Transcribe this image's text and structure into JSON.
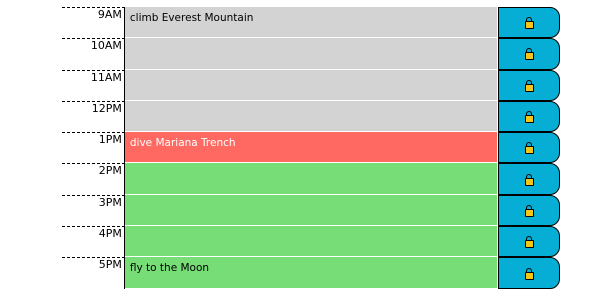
{
  "schedule": {
    "rows": [
      {
        "hour": "9AM",
        "text": "climb Everest Mountain",
        "state": "past"
      },
      {
        "hour": "10AM",
        "text": "",
        "state": "past"
      },
      {
        "hour": "11AM",
        "text": "",
        "state": "past"
      },
      {
        "hour": "12PM",
        "text": "",
        "state": "past"
      },
      {
        "hour": "1PM",
        "text": "dive Mariana Trench",
        "state": "present"
      },
      {
        "hour": "2PM",
        "text": "",
        "state": "future"
      },
      {
        "hour": "3PM",
        "text": "",
        "state": "future"
      },
      {
        "hour": "4PM",
        "text": "",
        "state": "future"
      },
      {
        "hour": "5PM",
        "text": "fly to the Moon",
        "state": "future"
      }
    ],
    "save_icon": "lock-icon"
  },
  "colors": {
    "past": "#d3d3d3",
    "present": "#ff6961",
    "future": "#77dd77",
    "save": "#06aed5"
  }
}
